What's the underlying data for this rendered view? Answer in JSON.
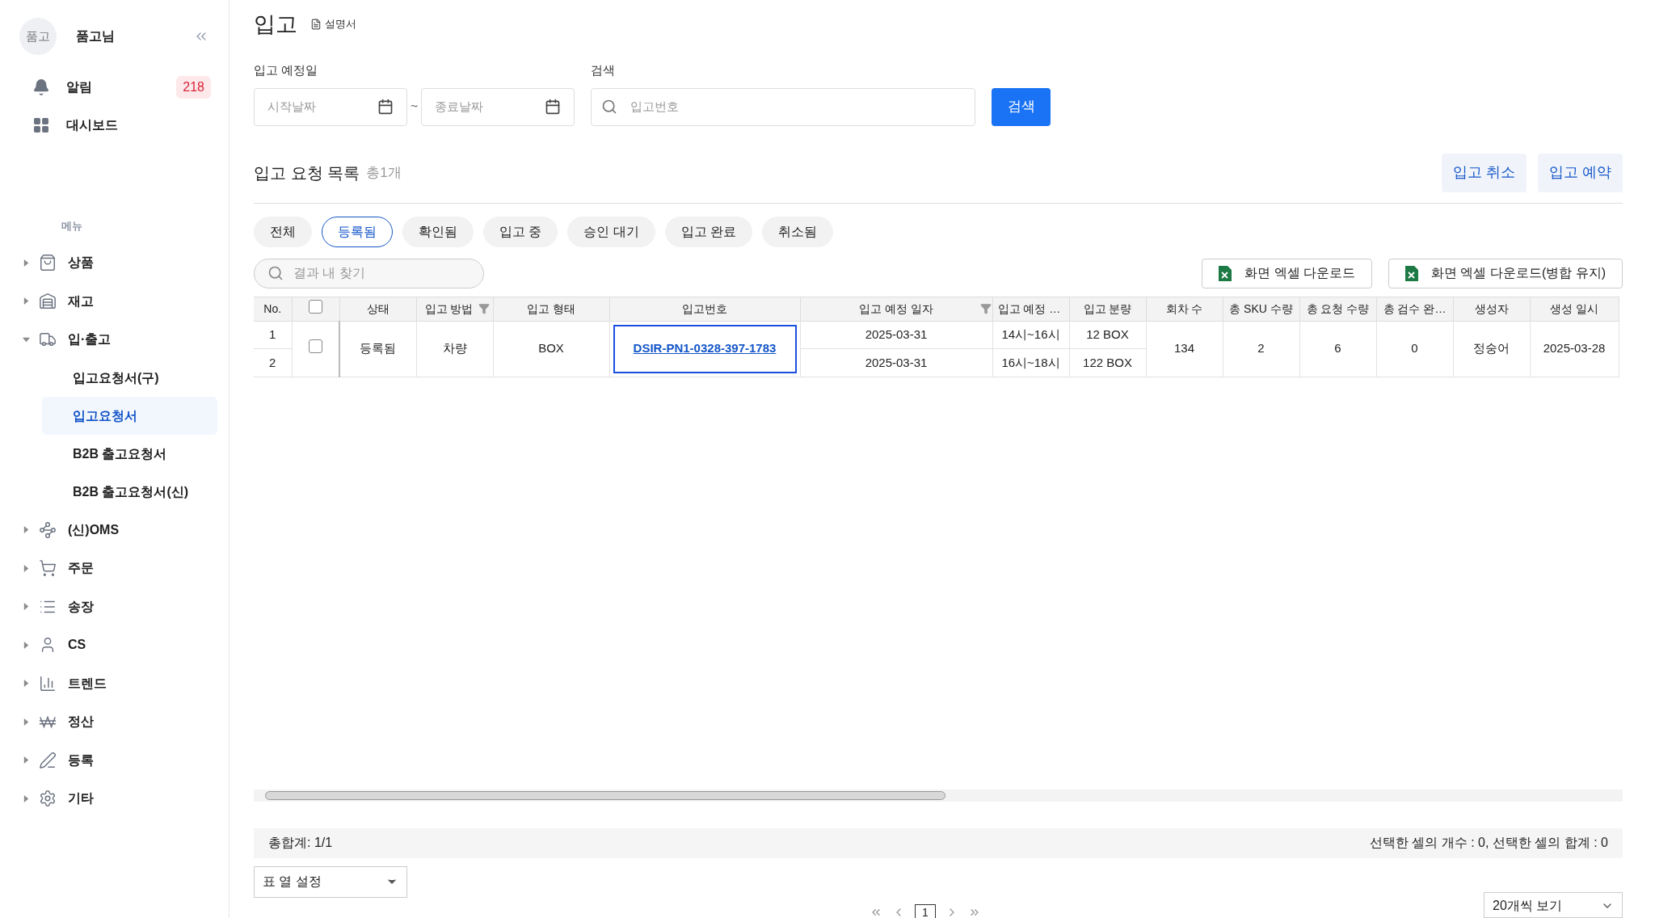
{
  "profile": {
    "avatar": "품고",
    "name": "품고님"
  },
  "quick_links": [
    {
      "label": "알림",
      "badge": "218"
    },
    {
      "label": "대시보드"
    }
  ],
  "menu_heading": "메뉴",
  "menu": [
    {
      "label": "상품",
      "expanded": false
    },
    {
      "label": "재고",
      "expanded": false
    },
    {
      "label": "입·출고",
      "expanded": true,
      "children": [
        {
          "label": "입고요청서(구)",
          "selected": false
        },
        {
          "label": "입고요청서",
          "selected": true
        },
        {
          "label": "B2B 출고요청서",
          "selected": false
        },
        {
          "label": "B2B 출고요청서(신)",
          "selected": false
        }
      ]
    },
    {
      "label": "(신)OMS",
      "expanded": false
    },
    {
      "label": "주문",
      "expanded": false
    },
    {
      "label": "송장",
      "expanded": false
    },
    {
      "label": "CS",
      "expanded": false
    },
    {
      "label": "트렌드",
      "expanded": false
    },
    {
      "label": "정산",
      "expanded": false
    },
    {
      "label": "등록",
      "expanded": false
    },
    {
      "label": "기타",
      "expanded": false
    }
  ],
  "page": {
    "title": "입고",
    "manual_link": "설명서"
  },
  "filters": {
    "date_label": "입고 예정일",
    "start_placeholder": "시작날짜",
    "separator": "~",
    "end_placeholder": "종료날짜",
    "search_label": "검색",
    "search_placeholder": "입고번호",
    "search_button": "검색"
  },
  "list": {
    "title": "입고 요청 목록",
    "count": "총1개",
    "actions": [
      "입고 취소",
      "입고 예약"
    ]
  },
  "status_tabs": [
    {
      "label": "전체",
      "selected": false
    },
    {
      "label": "등록됨",
      "selected": true
    },
    {
      "label": "확인됨",
      "selected": false
    },
    {
      "label": "입고 중",
      "selected": false
    },
    {
      "label": "승인 대기",
      "selected": false
    },
    {
      "label": "입고 완료",
      "selected": false
    },
    {
      "label": "취소됨",
      "selected": false
    }
  ],
  "result_search_placeholder": "결과 내 찾기",
  "export_buttons": [
    "화면 엑셀 다운로드",
    "화면 엑셀 다운로드(병합 유지)"
  ],
  "table": {
    "header_checkbox_checked": false,
    "columns": [
      {
        "label": "No.",
        "kind": "text"
      },
      {
        "kind": "checkbox"
      },
      {
        "label": "상태",
        "kind": "text"
      },
      {
        "label": "입고 방법",
        "kind": "filter"
      },
      {
        "label": "입고 형태",
        "kind": "text"
      },
      {
        "label": "입고번호",
        "kind": "text"
      },
      {
        "label": "입고 예정 일자",
        "kind": "text"
      },
      {
        "label": "입고 예정 …",
        "kind": "filter_left"
      },
      {
        "label": "입고 분량",
        "kind": "text"
      },
      {
        "label": "회차 수",
        "kind": "text"
      },
      {
        "label": "총 SKU 수량",
        "kind": "text"
      },
      {
        "label": "총 요청 수량",
        "kind": "text"
      },
      {
        "label": "총 검수 완…",
        "kind": "text"
      },
      {
        "label": "생성자",
        "kind": "text"
      },
      {
        "label": "생성 일시",
        "kind": "text"
      }
    ],
    "group": {
      "checked": false,
      "status": "등록됨",
      "method": "차량",
      "type": "BOX",
      "number": "DSIR-PN1-0328-397-1783",
      "rounds": "134",
      "sku": "2",
      "requested": "6",
      "inspected": "0",
      "creator": "정숭어",
      "created": "2025-03-28"
    },
    "rows": [
      {
        "no": "1",
        "date": "2025-03-31",
        "time": "14시~16시",
        "quantity": "12 BOX"
      },
      {
        "no": "2",
        "date": "2025-03-31",
        "time": "16시~18시",
        "quantity": "122 BOX"
      }
    ]
  },
  "footer": {
    "total": "총합계: 1/1",
    "selection": "선택한 셀의 개수 : 0, 선택한 셀의 합계 : 0",
    "column_settings": "표 열 설정",
    "page": "1",
    "page_size": "20개씩 보기"
  }
}
